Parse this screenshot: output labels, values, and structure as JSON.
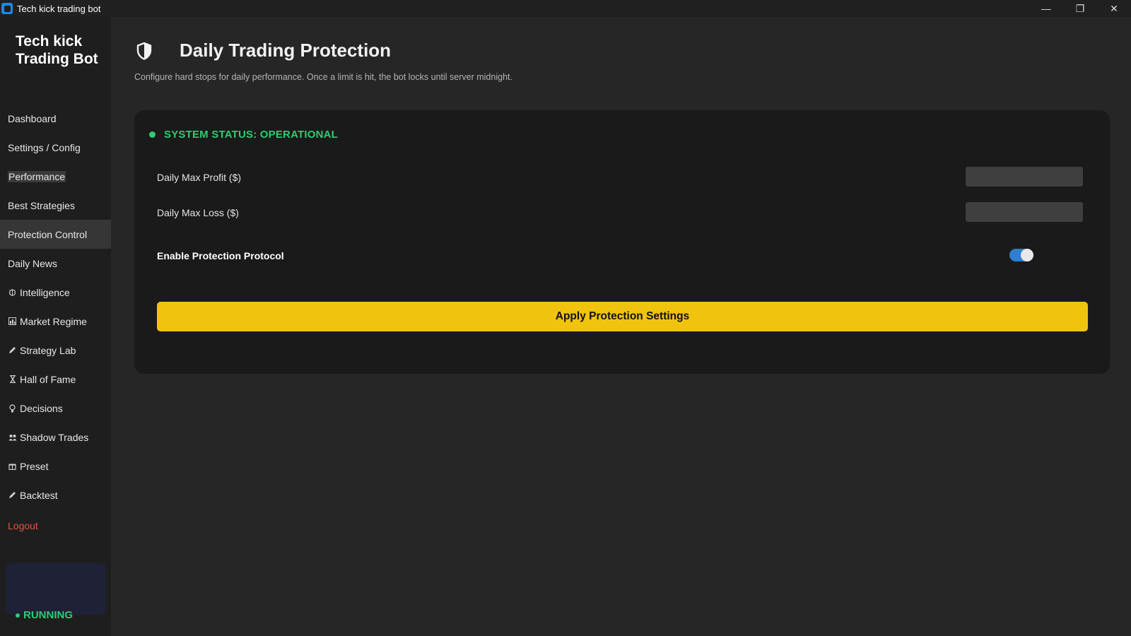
{
  "window": {
    "title": "Tech kick trading bot",
    "controls": {
      "minimize": "—",
      "restore": "❐",
      "close": "✕"
    }
  },
  "sidebar": {
    "brand_line1": "Tech kick",
    "brand_line2": "Trading Bot",
    "items": [
      {
        "label": "Dashboard",
        "icon": ""
      },
      {
        "label": "Settings / Config",
        "icon": ""
      },
      {
        "label": "Performance",
        "icon": ""
      },
      {
        "label": "Best Strategies",
        "icon": ""
      },
      {
        "label": "Protection Control",
        "icon": "",
        "active": true
      },
      {
        "label": "Daily News",
        "icon": ""
      },
      {
        "label": "Intelligence",
        "icon": "brain-icon"
      },
      {
        "label": "Market Regime",
        "icon": "bar-chart-icon"
      },
      {
        "label": "Strategy Lab",
        "icon": "pencil-icon"
      },
      {
        "label": "Hall of Fame",
        "icon": "hourglass-icon"
      },
      {
        "label": "Decisions",
        "icon": "lightbulb-icon"
      },
      {
        "label": "Shadow Trades",
        "icon": "people-icon"
      },
      {
        "label": "Preset",
        "icon": "gift-icon"
      },
      {
        "label": "Backtest",
        "icon": "pencil-icon"
      }
    ],
    "logout": "Logout",
    "status": "RUNNING"
  },
  "header": {
    "title": "Daily Trading Protection",
    "subtitle": "Configure hard stops for daily performance. Once a limit is hit, the bot locks until server midnight."
  },
  "card": {
    "status": "SYSTEM STATUS: OPERATIONAL",
    "max_profit_label": "Daily Max Profit ($)",
    "max_loss_label": "Daily Max Loss ($)",
    "protocol_label": "Enable Protection Protocol",
    "protocol_enabled": true,
    "apply_label": "Apply Protection Settings"
  },
  "colors": {
    "accent_yellow": "#f0c30f",
    "status_green": "#2ecc71",
    "logout_red": "#e05345",
    "toggle_blue": "#2d7fd1"
  }
}
